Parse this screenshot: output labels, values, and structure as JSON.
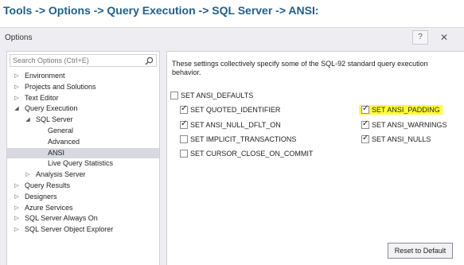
{
  "header": {
    "path": "Tools -> Options -> Query Execution -> SQL Server -> ANSI:"
  },
  "dialog": {
    "title": "Options",
    "help_label": "?",
    "close_label": "✕"
  },
  "search": {
    "placeholder": "Search Options (Ctrl+E)",
    "icon": "search-icon"
  },
  "tree": {
    "items": [
      {
        "label": "Environment",
        "arrow": "▷"
      },
      {
        "label": "Projects and Solutions",
        "arrow": "▷"
      },
      {
        "label": "Text Editor",
        "arrow": "▷"
      },
      {
        "label": "Query Execution",
        "arrow": "◢"
      },
      {
        "label": "SQL Server",
        "arrow": "◢"
      },
      {
        "label": "General",
        "arrow": ""
      },
      {
        "label": "Advanced",
        "arrow": ""
      },
      {
        "label": "ANSI",
        "arrow": ""
      },
      {
        "label": "Live Query Statistics",
        "arrow": ""
      },
      {
        "label": "Analysis Server",
        "arrow": "▷"
      },
      {
        "label": "Query Results",
        "arrow": "▷"
      },
      {
        "label": "Designers",
        "arrow": "▷"
      },
      {
        "label": "Azure Services",
        "arrow": "▷"
      },
      {
        "label": "SQL Server Always On",
        "arrow": "▷"
      },
      {
        "label": "SQL Server Object Explorer",
        "arrow": "▷"
      }
    ]
  },
  "content": {
    "description": "These settings collectively specify some of the SQL-92 standard query execution behavior.",
    "options": {
      "ansi_defaults": {
        "label": "SET ANSI_DEFAULTS",
        "checked": false
      },
      "quoted_identifier": {
        "label": "SET QUOTED_IDENTIFIER",
        "checked": true
      },
      "ansi_null_dflt_on": {
        "label": "SET ANSI_NULL_DFLT_ON",
        "checked": true
      },
      "implicit_transactions": {
        "label": "SET IMPLICIT_TRANSACTIONS",
        "checked": false
      },
      "cursor_close_on_commit": {
        "label": "SET CURSOR_CLOSE_ON_COMMIT",
        "checked": false
      },
      "ansi_padding": {
        "label": "SET ANSI_PADDING",
        "checked": true
      },
      "ansi_warnings": {
        "label": "SET ANSI_WARNINGS",
        "checked": true
      },
      "ansi_nulls": {
        "label": "SET ANSI_NULLS",
        "checked": true
      }
    },
    "highlight_color": "#ffff33",
    "reset_label": "Reset to Default"
  }
}
